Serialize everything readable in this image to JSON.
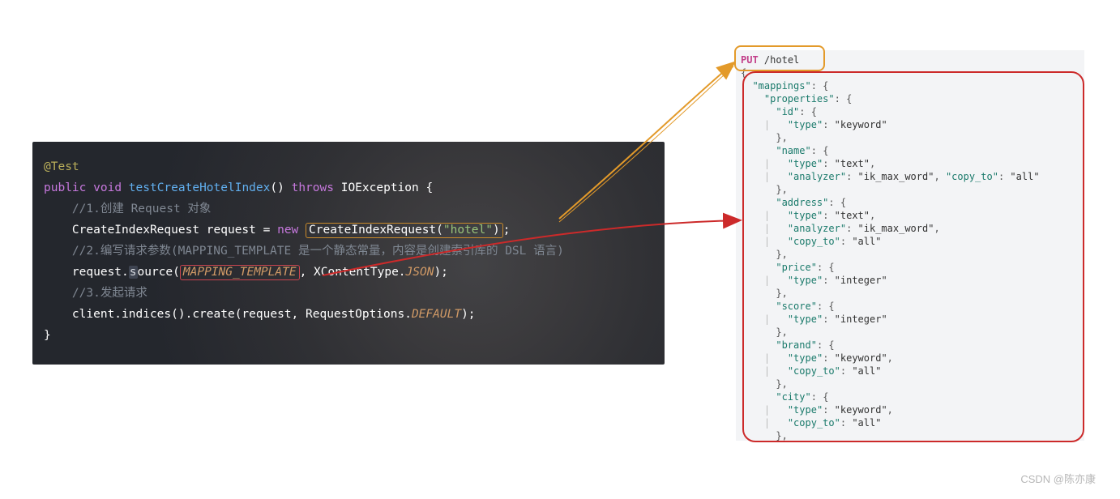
{
  "java": {
    "anno": "@Test",
    "sig1": "public",
    "sig2": "void",
    "fn": "testCreateHotelIndex",
    "sig3": "()",
    "sig4": "throws",
    "sig5": "IOException {",
    "c1": "//1.创建 Request 对象",
    "l2a": "CreateIndexRequest request = ",
    "l2b": "new ",
    "l2c": "CreateIndexRequest(",
    "l2d": "\"hotel\"",
    "l2e": ")",
    "l2f": ";",
    "c2": "//2.编写请求参数(MAPPING_TEMPLATE 是一个静态常量，内容是创建索引库的 DSL 语言)",
    "l3a": "request.",
    "l3b": "s",
    "l3c": "ource",
    "l3d": "(",
    "l3e": "MAPPING_TEMPLATE",
    "l3f": ", XContentType.",
    "l3g": "JSON",
    "l3h": ");",
    "c3": "//3.发起请求",
    "l4a": "client.indices().create(request, RequestOptions.",
    "l4b": "DEFAULT",
    "l4c": ");",
    "close": "}"
  },
  "json": {
    "put": "PUT",
    "path": "/hotel",
    "body": "{\n  \"mappings\": {\n    \"properties\": {\n      \"id\": {\n    |   \"type\": \"keyword\"\n      },\n      \"name\": {\n    |   \"type\": \"text\",\n    |   \"analyzer\": \"ik_max_word\", \"copy_to\": \"all\"\n      },\n      \"address\": {\n    |   \"type\": \"text\",\n    |   \"analyzer\": \"ik_max_word\",\n    |   \"copy_to\": \"all\"\n      },\n      \"price\": {\n    |   \"type\": \"integer\"\n      },\n      \"score\": {\n    |   \"type\": \"integer\"\n      },\n      \"brand\": {\n    |   \"type\": \"keyword\",\n    |   \"copy_to\": \"all\"\n      },\n      \"city\": {\n    |   \"type\": \"keyword\",\n    |   \"copy_to\": \"all\"\n      },"
  },
  "watermark": "CSDN @陈亦康"
}
